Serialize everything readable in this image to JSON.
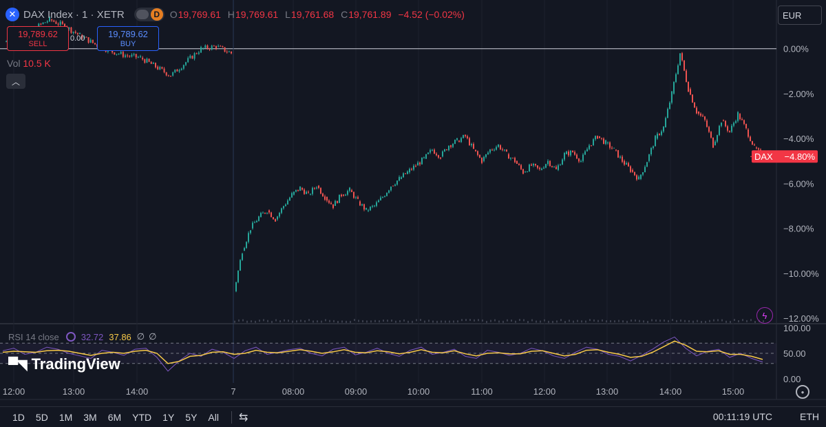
{
  "header": {
    "symbol_icon": "x-icon",
    "title": "DAX Index · 1 · XETR",
    "session_badge": "D",
    "ohlc": {
      "o_label": "O",
      "o": "19,769.61",
      "h_label": "H",
      "h": "19,769.61",
      "l_label": "L",
      "l": "19,761.68",
      "c_label": "C",
      "c": "19,761.89",
      "change": "−4.52 (−0.02%)"
    }
  },
  "trade": {
    "sell_price": "19,789.62",
    "sell_label": "SELL",
    "buy_price": "19,789.62",
    "buy_label": "BUY",
    "spread": "0.00"
  },
  "volume": {
    "label": "Vol",
    "value": "10.5 K"
  },
  "currency": "EUR",
  "price_tag": {
    "symbol": "DAX",
    "value": "−4.80%"
  },
  "rsi": {
    "label": "RSI 14 close",
    "value": "32.72",
    "ma_value": "37.86",
    "na1": "∅",
    "na2": "∅"
  },
  "logo_text": "TradingView",
  "bottom_bar": {
    "ranges": [
      "1D",
      "5D",
      "1M",
      "3M",
      "6M",
      "YTD",
      "1Y",
      "5Y",
      "All"
    ],
    "time": "00:11:19 UTC",
    "session": "ETH"
  },
  "colors": {
    "up": "#26a69a",
    "down": "#ef5350",
    "bg": "#131722",
    "rsi_line": "#7e57c2",
    "rsi_ma": "#f7c948"
  },
  "chart_data": {
    "type": "line",
    "title": "",
    "xlabel": "",
    "ylabel": "",
    "x_ticks": [
      "12:00",
      "13:00",
      "14:00",
      "7",
      "08:00",
      "09:00",
      "10:00",
      "11:00",
      "12:00",
      "13:00",
      "14:00",
      "15:00"
    ],
    "y_ticks": [
      "0.00%",
      "−2.00%",
      "−4.00%",
      "−6.00%",
      "−8.00%",
      "−10.00%",
      "−12.00%"
    ],
    "ylim": [
      -12,
      1.8
    ],
    "reference_line": 0,
    "series": [
      {
        "values_pct": [
          0.3,
          0.5,
          0.9,
          1.3,
          1.0,
          0.6,
          0.2,
          -0.1,
          -0.3,
          -0.4,
          -0.8,
          -1.2,
          -0.6,
          0.0,
          0.1,
          -0.2,
          -10.8,
          -9.0,
          -8.0,
          -7.5,
          -7.2,
          -7.6,
          -7.0,
          -6.5,
          -6.2,
          -6.5,
          -6.1,
          -6.6,
          -7.0,
          -6.5,
          -6.3,
          -6.8,
          -7.2,
          -7.0,
          -6.6,
          -6.1,
          -5.8,
          -5.5,
          -5.2,
          -4.9,
          -4.5,
          -4.8,
          -4.3,
          -4.1,
          -3.9,
          -4.5,
          -5.0,
          -4.5,
          -4.3,
          -4.7,
          -5.0,
          -5.5,
          -5.2,
          -5.4,
          -5.0,
          -5.4,
          -4.7,
          -4.6,
          -5.0,
          -4.3,
          -3.9,
          -4.2,
          -4.5,
          -5.0,
          -5.4,
          -5.8,
          -5.0,
          -4.0,
          -3.5,
          -2.0,
          -0.2,
          -1.8,
          -2.8,
          -3.2,
          -4.3,
          -3.2,
          -3.7,
          -2.9,
          -3.6,
          -4.4,
          -4.8
        ]
      }
    ],
    "rsi_ylim": [
      0,
      100
    ],
    "rsi_levels": [
      "100.00",
      "50.00",
      "0.00"
    ],
    "rsi_values": [
      55,
      60,
      48,
      52,
      62,
      58,
      50,
      45,
      40,
      56,
      52,
      46,
      58,
      60,
      42,
      15,
      35,
      50,
      44,
      58,
      52,
      40,
      55,
      62,
      48,
      52,
      57,
      60,
      50,
      45,
      58,
      62,
      47,
      52,
      60,
      50,
      44,
      56,
      62,
      48,
      52,
      58,
      44,
      40,
      56,
      52,
      46,
      50,
      60,
      55,
      45,
      40,
      52,
      62,
      58,
      48,
      44,
      35,
      46,
      58,
      72,
      82,
      60,
      45,
      54,
      58,
      42,
      50,
      40,
      33
    ],
    "rsi_ma_values": [
      52,
      54,
      53,
      52,
      55,
      56,
      54,
      50,
      46,
      50,
      52,
      50,
      54,
      56,
      50,
      30,
      34,
      44,
      46,
      52,
      53,
      48,
      50,
      56,
      52,
      51,
      54,
      57,
      54,
      50,
      53,
      57,
      52,
      51,
      55,
      53,
      49,
      52,
      57,
      52,
      51,
      55,
      49,
      45,
      50,
      51,
      49,
      49,
      54,
      55,
      50,
      45,
      48,
      56,
      57,
      52,
      48,
      42,
      44,
      52,
      63,
      74,
      66,
      54,
      53,
      55,
      48,
      48,
      44,
      38
    ]
  }
}
